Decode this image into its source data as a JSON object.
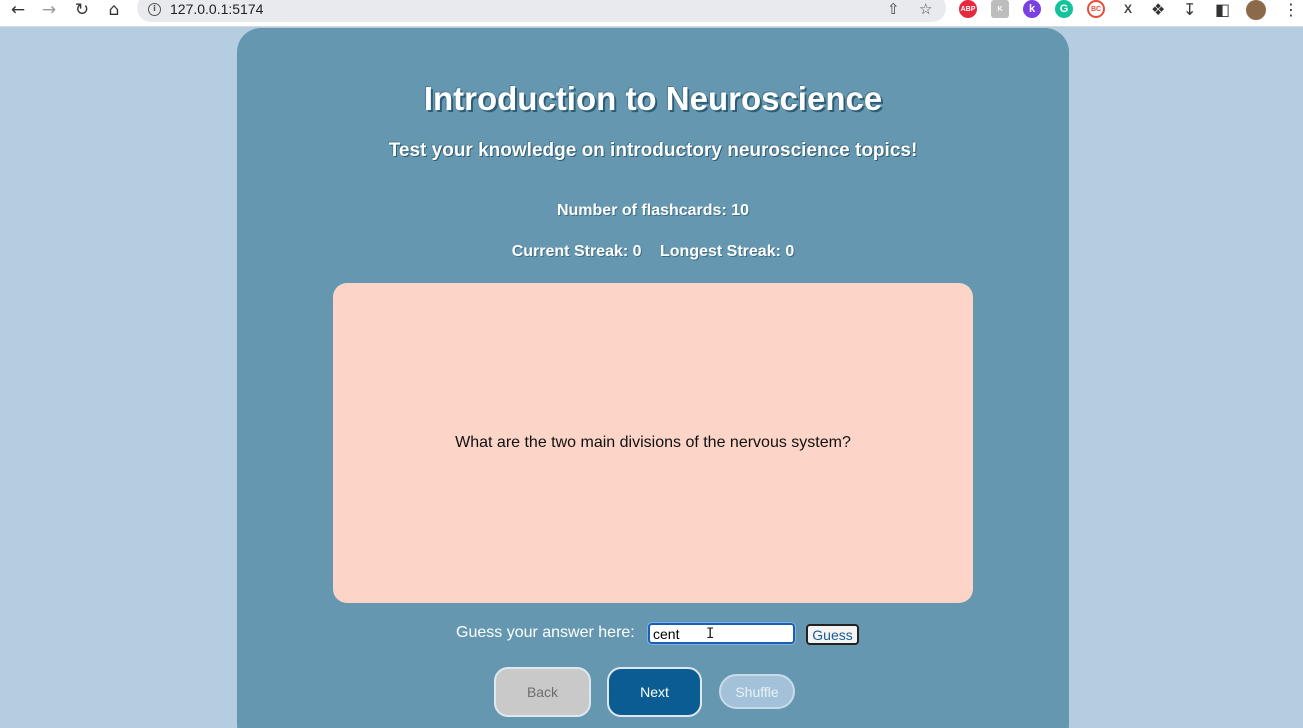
{
  "browser": {
    "url": "127.0.0.1:5174",
    "extensions": [
      {
        "name": "adblock-plus-icon",
        "label": "ABP",
        "color": "#e8283f"
      },
      {
        "name": "extension-k-gray-icon",
        "label": "K",
        "color": "#bdbdbd"
      },
      {
        "name": "extension-k-purple-icon",
        "label": "k",
        "color": "#7b3fe4"
      },
      {
        "name": "grammarly-icon",
        "label": "G",
        "color": "#15c39a"
      },
      {
        "name": "extension-red-ring-icon",
        "label": "BC",
        "color": "#e84d3c"
      },
      {
        "name": "extension-x-icon",
        "label": "X",
        "color": "#444444"
      }
    ]
  },
  "app": {
    "title": "Introduction to Neuroscience",
    "subtitle": "Test your knowledge on introductory neuroscience topics!",
    "count_text": "Number of flashcards: 10",
    "current_streak": "Current Streak: 0",
    "longest_streak": "Longest Streak: 0",
    "card_question": "What are the two main divisions of the nervous system?",
    "guess_label": "Guess your answer here:",
    "guess_value": "cent",
    "guess_button": "Guess",
    "back_button": "Back",
    "next_button": "Next",
    "shuffle_button": "Shuffle"
  },
  "colors": {
    "page_bg": "#b4cde0",
    "panel_bg": "#6598b0",
    "card_bg": "#fcd5c8",
    "next_bg": "#0b5c93",
    "back_bg": "#c9c9c9",
    "shuffle_bg": "#a3c2da"
  }
}
